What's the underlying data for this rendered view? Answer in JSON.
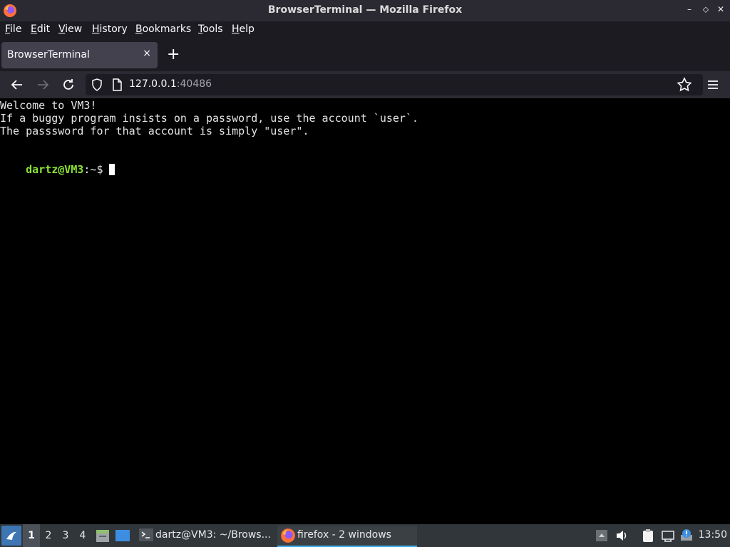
{
  "window": {
    "title": "BrowserTerminal — Mozilla Firefox",
    "controls": [
      "–",
      "⬦",
      "✕"
    ]
  },
  "menu": {
    "items": [
      {
        "access": "F",
        "rest": "ile"
      },
      {
        "access": "E",
        "rest": "dit"
      },
      {
        "access": "V",
        "rest": "iew"
      },
      {
        "access": "H",
        "rest": "istory"
      },
      {
        "access": "B",
        "rest": "ookmarks"
      },
      {
        "access": "T",
        "rest": "ools"
      },
      {
        "access": "H",
        "rest": "elp"
      }
    ]
  },
  "tabs": [
    {
      "label": "BrowserTerminal",
      "close": "×"
    }
  ],
  "newtab": "+",
  "urlbar": {
    "host": "127.0.0.1",
    "port": ":40486"
  },
  "terminal": {
    "lines": [
      "Welcome to VM3!",
      "If a buggy program insists on a password, use the account `user`.",
      "The passsword for that account is simply \"user\"."
    ],
    "prompt_user": "dartz@VM3",
    "prompt_path": ":~$"
  },
  "taskbar": {
    "workspaces": [
      "1",
      "2",
      "3",
      "4"
    ],
    "active_workspace": "1",
    "tasks": [
      {
        "label": "dartz@VM3: ~/Brows...",
        "icon": "terminal-icon",
        "active": false
      },
      {
        "label": "firefox - 2 windows",
        "icon": "firefox-icon",
        "active": true
      }
    ],
    "clock": "13:50"
  },
  "colors": {
    "accent": "#3daee9",
    "prompt_green": "#8ae234",
    "terminal_bg": "#000000"
  }
}
